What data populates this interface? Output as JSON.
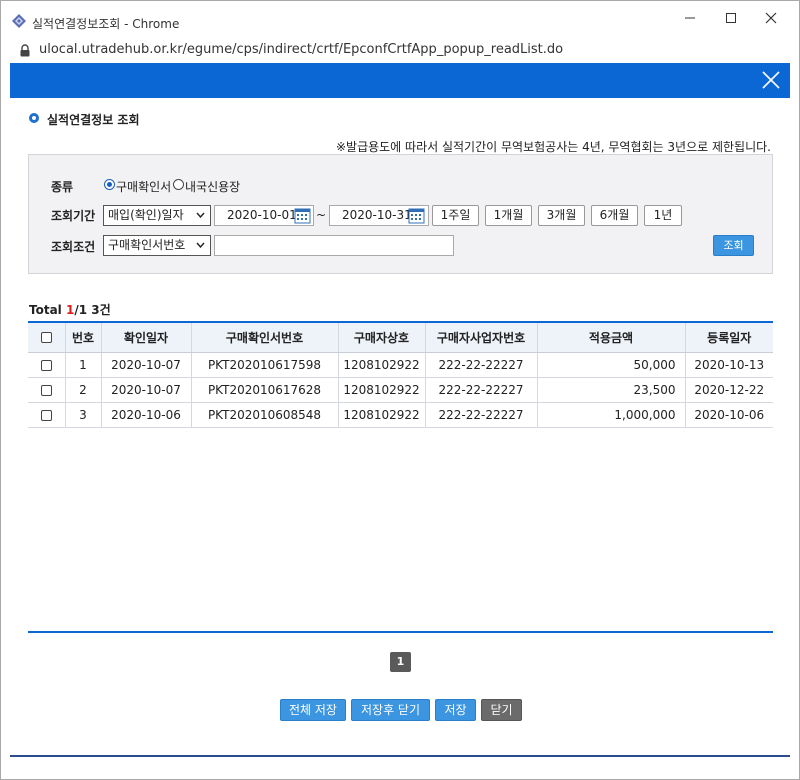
{
  "window": {
    "title": "실적연결정보조회 - Chrome",
    "url": "ulocal.utradehub.or.kr/egume/cps/indirect/crtf/EpconfCrtfApp_popup_readList.do"
  },
  "page": {
    "section_title": "실적연결정보 조회",
    "notice": "※발급용도에 따라서 실적기간이 무역보험공사는 4년, 무역협회는 3년으로 제한됩니다."
  },
  "search": {
    "type_label": "종류",
    "type_options": [
      "구매확인서",
      "내국신용장"
    ],
    "type_selected": "구매확인서",
    "period_label": "조회기간",
    "period_select": "매입(확인)일자",
    "date_from": "2020-10-01",
    "date_to": "2020-10-31",
    "tilde": "~",
    "period_buttons": [
      "1주일",
      "1개월",
      "3개월",
      "6개월",
      "1년"
    ],
    "condition_label": "조회조건",
    "condition_select": "구매확인서번호",
    "condition_value": "",
    "search_button": "조회"
  },
  "total": {
    "prefix": "Total",
    "current_page": "1",
    "rest": "/1 3건"
  },
  "table": {
    "headers": [
      "번호",
      "확인일자",
      "구매확인서번호",
      "구매자상호",
      "구매자사업자번호",
      "적용금액",
      "등록일자"
    ],
    "rows": [
      [
        "1",
        "2020-10-07",
        "PKT202010617598",
        "1208102922",
        "222-22-22227",
        "50,000",
        "2020-10-13"
      ],
      [
        "2",
        "2020-10-07",
        "PKT202010617628",
        "1208102922",
        "222-22-22227",
        "23,500",
        "2020-12-22"
      ],
      [
        "3",
        "2020-10-06",
        "PKT202010608548",
        "1208102922",
        "222-22-22227",
        "1,000,000",
        "2020-10-06"
      ]
    ]
  },
  "pagination": {
    "page": "1"
  },
  "actions": {
    "save_all": "전체 저장",
    "save_close": "저장후 닫기",
    "save": "저장",
    "close": "닫기"
  },
  "colors": {
    "header_blue": "#0b67d4",
    "button_blue": "#3b95e0",
    "total_red": "#d81e1e"
  }
}
